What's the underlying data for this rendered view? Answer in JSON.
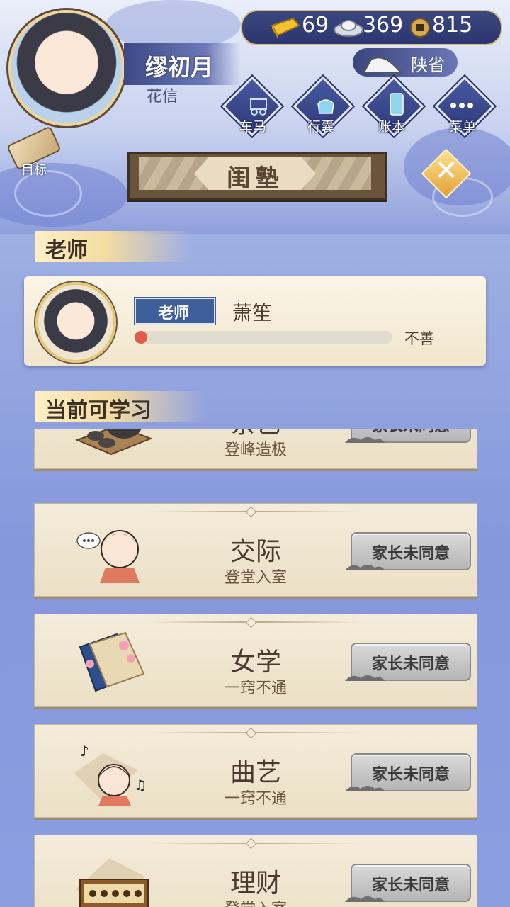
{
  "player": {
    "name": "缪初月",
    "title": "花信"
  },
  "currency": {
    "gold": "69",
    "silver": "369",
    "coins": "815"
  },
  "location": {
    "province": "陕省"
  },
  "menu": [
    {
      "label": "车马",
      "icon": "carriage-icon"
    },
    {
      "label": "行囊",
      "icon": "bundle-icon"
    },
    {
      "label": "账本",
      "icon": "ledger-icon"
    },
    {
      "label": "菜单",
      "icon": "more-dots-icon"
    }
  ],
  "goal": {
    "label": "目标",
    "icon": "scroll-icon"
  },
  "page": {
    "title": "闺塾",
    "close_icon": "close-icon"
  },
  "teacher_section": {
    "header": "老师",
    "tag": "老师",
    "name": "萧笙",
    "relation_label": "不善",
    "relation_fraction": 0.03
  },
  "learn_section": {
    "header": "当前可学习",
    "button_label": "家长未同意",
    "skills": [
      {
        "name": "茶艺",
        "level": "登峰造极",
        "icon": "tea-set-icon"
      },
      {
        "name": "交际",
        "level": "登堂入室",
        "icon": "chatting-girl-icon"
      },
      {
        "name": "女学",
        "level": "一窍不通",
        "icon": "book-flowers-icon"
      },
      {
        "name": "曲艺",
        "level": "一窍不通",
        "icon": "music-girl-icon"
      },
      {
        "name": "理财",
        "level": "登堂入室",
        "icon": "abacus-icon"
      }
    ]
  },
  "colors": {
    "accent": "#3f5f9a",
    "relation_bar": "#e25a4a",
    "panel": "#f4ecdb"
  }
}
